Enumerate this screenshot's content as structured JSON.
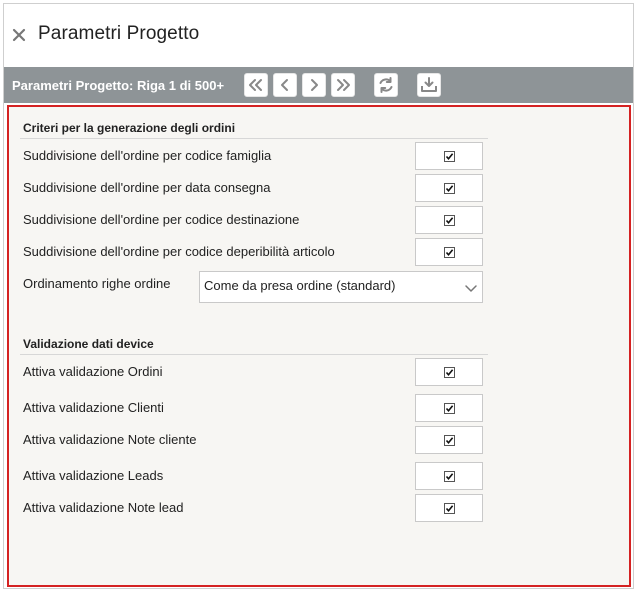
{
  "window": {
    "title": "Parametri Progetto",
    "close_icon": "close-icon"
  },
  "toolbar": {
    "label": "Parametri Progetto: Riga 1 di 500+",
    "buttons": [
      "first-page-icon",
      "prev-icon",
      "next-icon",
      "last-page-icon",
      "refresh-icon",
      "download-icon"
    ]
  },
  "sections": {
    "orders": {
      "heading": "Criteri per la generazione degli ordini",
      "rows": [
        {
          "label": "Suddivisione dell'ordine per codice famiglia",
          "checked": true
        },
        {
          "label": "Suddivisione dell'ordine per data consegna",
          "checked": true
        },
        {
          "label": "Suddivisione dell'ordine per codice destinazione",
          "checked": true
        },
        {
          "label": "Suddivisione dell'ordine per codice deperibilità articolo",
          "checked": true
        }
      ],
      "sort": {
        "label": "Ordinamento righe ordine",
        "value": "Come da presa ordine (standard)"
      }
    },
    "validation": {
      "heading": "Validazione dati device",
      "rows": [
        {
          "label": "Attiva validazione Ordini",
          "checked": true
        },
        {
          "label": "Attiva validazione Clienti",
          "checked": true
        },
        {
          "label": "Attiva validazione Note cliente",
          "checked": true
        },
        {
          "label": "Attiva validazione Leads",
          "checked": true
        },
        {
          "label": "Attiva validazione Note lead",
          "checked": true
        }
      ]
    }
  },
  "colors": {
    "toolbar_bg": "#8e9497",
    "content_border": "#d42222",
    "content_bg": "#f7f6f3"
  }
}
